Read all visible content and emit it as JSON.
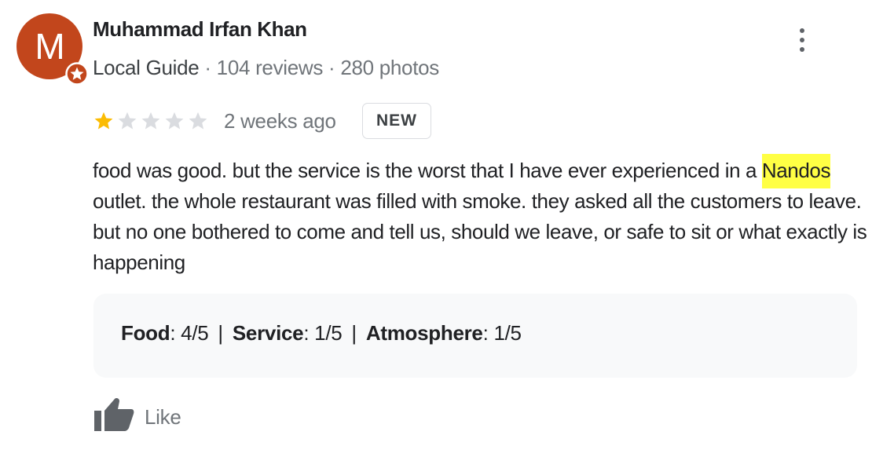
{
  "reviewer": {
    "avatar_initial": "M",
    "avatar_color": "#c2461c",
    "badge_icon": "local-guide-star-icon",
    "name": "Muhammad Irfan Khan",
    "guide_label": "Local Guide",
    "reviews": " · 104 reviews",
    "photos": " · 280 photos"
  },
  "menu": {
    "icon": "more-vert-icon"
  },
  "review": {
    "rating": 1,
    "rating_max": 5,
    "star_filled_color": "#fbbc04",
    "star_empty_color": "#dadce0",
    "time": "2 weeks ago",
    "badge": "NEW",
    "text_before": "food was good. but the service is the worst that I have ever experienced in a ",
    "highlight": "Nandos",
    "highlight_color": "#ffff44",
    "text_after": " outlet. the whole restaurant was filled with smoke. they asked all the customers to leave. but no one bothered to come and tell us, should we leave, or safe to sit or what exactly is happening"
  },
  "ratings": {
    "food_label": "Food",
    "food_value": ": 4/5",
    "service_label": "Service",
    "service_value": ": 1/5",
    "atmosphere_label": "Atmosphere",
    "atmosphere_value": ": 1/5",
    "separator": "|"
  },
  "actions": {
    "like_icon": "thumbs-up-icon",
    "like_label": "Like"
  }
}
